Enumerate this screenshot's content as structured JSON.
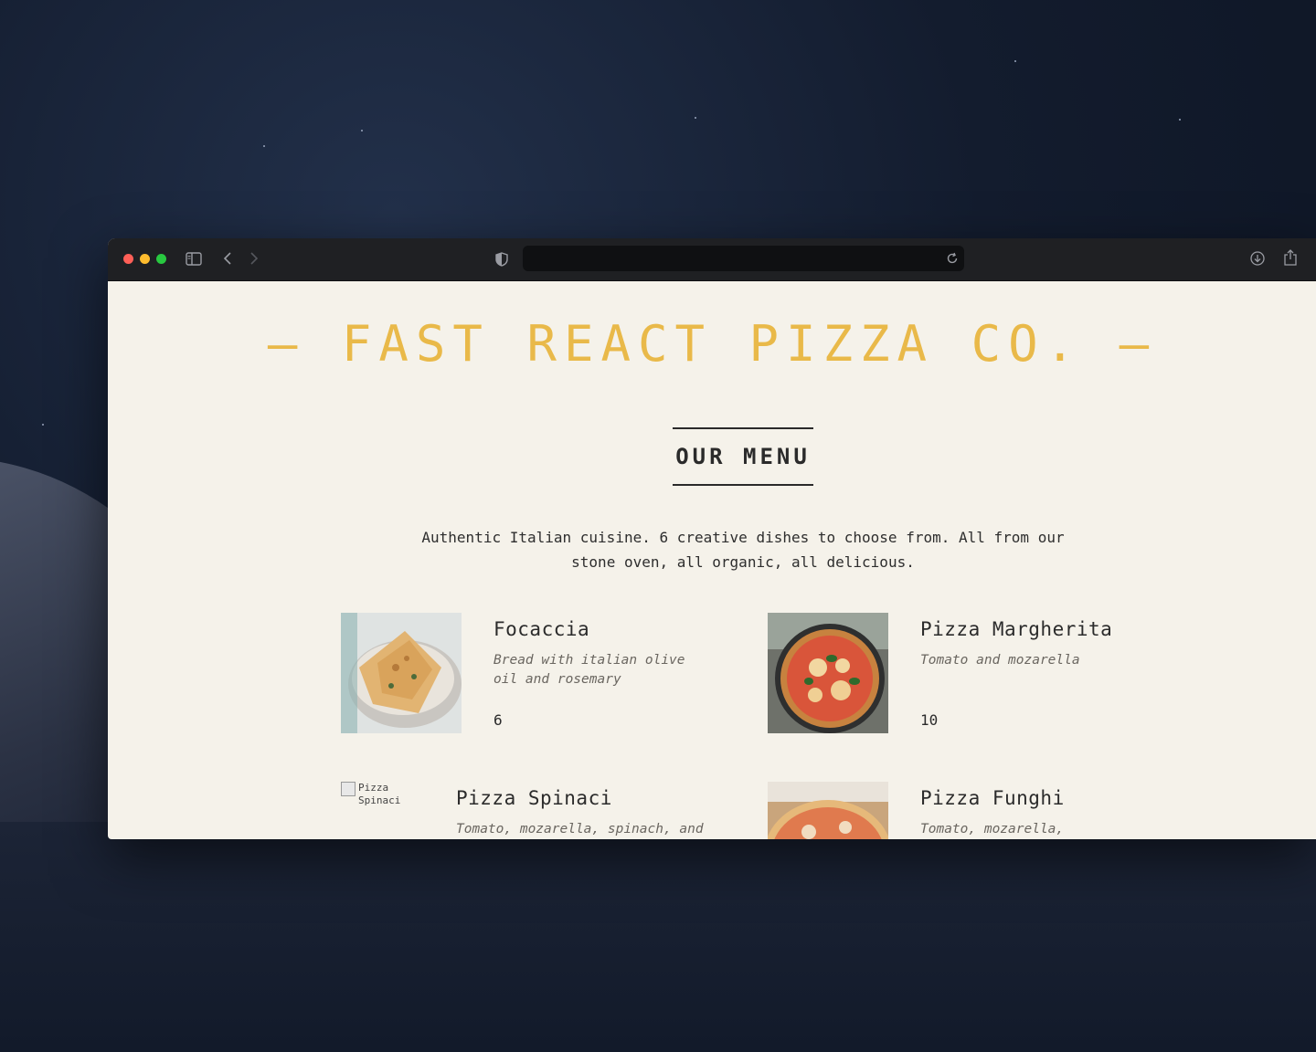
{
  "browser": {
    "traffic_lights": [
      "#fe5f57",
      "#febc2e",
      "#28c840"
    ],
    "icons": [
      "sidebar-icon",
      "back-icon",
      "forward-icon",
      "shield-icon",
      "reload-icon",
      "download-icon",
      "share-icon"
    ],
    "url": ""
  },
  "page": {
    "brand": "FAST REACT PIZZA CO.",
    "brand_color": "#e9b949",
    "heading": "OUR MENU",
    "intro": "Authentic Italian cuisine. 6 creative dishes to choose from. All from our stone oven, all organic, all delicious.",
    "menu": [
      {
        "name": "Focaccia",
        "ingredients": "Bread with italian olive oil and rosemary",
        "price": "6"
      },
      {
        "name": "Pizza Margherita",
        "ingredients": "Tomato and mozarella",
        "price": "10"
      },
      {
        "name": "Pizza Spinaci",
        "ingredients": "Tomato, mozarella, spinach, and",
        "price": "",
        "alt": "Pizza Spinaci"
      },
      {
        "name": "Pizza Funghi",
        "ingredients": "Tomato, mozarella,",
        "price": ""
      }
    ]
  }
}
